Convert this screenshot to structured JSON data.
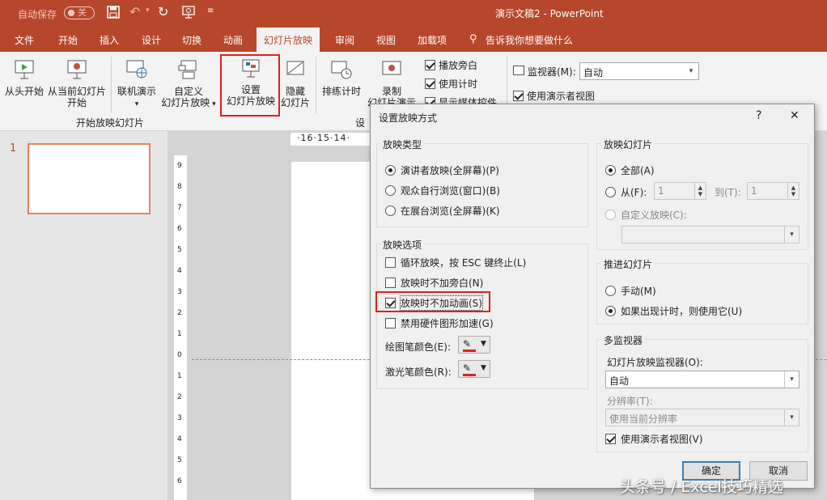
{
  "titlebar": {
    "autosave_label": "自动保存",
    "autosave_state": "关",
    "doc_title": "演示文稿2 - PowerPoint"
  },
  "tabs": [
    "文件",
    "开始",
    "插入",
    "设计",
    "切换",
    "动画",
    "幻灯片放映",
    "审阅",
    "视图",
    "加载项"
  ],
  "tell_me": "告诉我你想要做什么",
  "ribbon": {
    "from_start": "从头开始",
    "from_current_1": "从当前幻灯片",
    "from_current_2": "开始",
    "online_present": "联机演示",
    "custom_1": "自定义",
    "custom_2": "幻灯片放映",
    "setup_1": "设置",
    "setup_2": "幻灯片放映",
    "hide_1": "隐藏",
    "hide_2": "幻灯片",
    "rehearse": "排练计时",
    "record_1": "录制",
    "record_2": "幻灯片演示",
    "group_start": "开始放映幻灯片",
    "group_setup": "设",
    "play_narration": "播放旁白",
    "use_timings": "使用计时",
    "show_media": "显示媒体控件",
    "monitor_label": "监视器(M):",
    "monitor_value": "自动",
    "presenter_view": "使用演示者视图"
  },
  "slide_number": "1",
  "ruler_top": "·16·15·14·",
  "ruler_left": [
    "9",
    "8",
    "7",
    "6",
    "5",
    "4",
    "3",
    "2",
    "1",
    "0",
    "1",
    "2",
    "3",
    "4",
    "5",
    "6"
  ],
  "dialog": {
    "title": "设置放映方式",
    "help": "?",
    "close": "✕",
    "show_type": {
      "title": "放映类型",
      "options": [
        "演讲者放映(全屏幕)(P)",
        "观众自行浏览(窗口)(B)",
        "在展台浏览(全屏幕)(K)"
      ]
    },
    "show_options": {
      "title": "放映选项",
      "loop": "循环放映，按 ESC 键终止(L)",
      "no_narration": "放映时不加旁白(N)",
      "no_animation": "放映时不加动画(S)",
      "disable_hw": "禁用硬件图形加速(G)",
      "pen_color": "绘图笔颜色(E):",
      "laser_color": "激光笔颜色(R):"
    },
    "show_slides": {
      "title": "放映幻灯片",
      "all": "全部(A)",
      "from": "从(F):",
      "from_value": "1",
      "to": "到(T):",
      "to_value": "1",
      "custom": "自定义放映(C):"
    },
    "advance": {
      "title": "推进幻灯片",
      "manual": "手动(M)",
      "timings": "如果出现计时，则使用它(U)"
    },
    "multi_monitor": {
      "title": "多监视器",
      "monitor_label": "幻灯片放映监视器(O):",
      "monitor_value": "自动",
      "resolution_label": "分辨率(T):",
      "resolution_value": "使用当前分辨率",
      "presenter_view": "使用演示者视图(V)"
    },
    "ok": "确定",
    "cancel": "取消"
  },
  "watermark": "头条号 / Excel技巧精选",
  "colors": {
    "accent": "#b7472a",
    "highlight": "#e02020",
    "pen": "#e02020"
  }
}
